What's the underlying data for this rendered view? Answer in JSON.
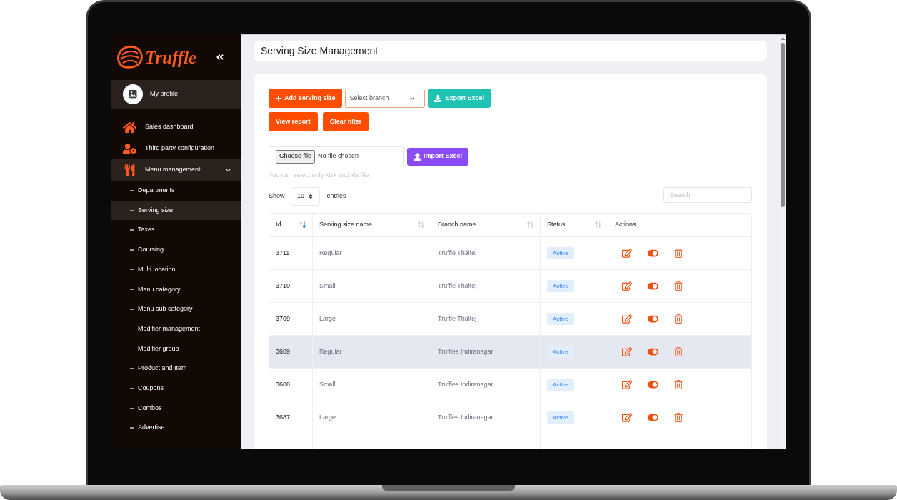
{
  "sidebar": {
    "brand": "Truffle",
    "profile": {
      "label": "My profile"
    },
    "items": [
      {
        "label": "Sales dashboard",
        "selected": false
      },
      {
        "label": "Third party configuration",
        "selected": false
      },
      {
        "label": "Menu management",
        "selected": true,
        "expanded": true,
        "children": [
          {
            "label": "Departments",
            "selected": false
          },
          {
            "label": "Serving size",
            "selected": true
          },
          {
            "label": "Taxes",
            "selected": false
          },
          {
            "label": "Coursing",
            "selected": false
          },
          {
            "label": "Multi location",
            "selected": false
          },
          {
            "label": "Menu category",
            "selected": false
          },
          {
            "label": "Menu sub category",
            "selected": false
          },
          {
            "label": "Modifier management",
            "selected": false
          },
          {
            "label": "Modifier group",
            "selected": false
          },
          {
            "label": "Product and Item",
            "selected": false
          },
          {
            "label": "Coupons",
            "selected": false
          },
          {
            "label": "Combos",
            "selected": false
          },
          {
            "label": "Advertise",
            "selected": false
          }
        ]
      }
    ]
  },
  "header": {
    "title": "Serving Size Management"
  },
  "toolbar": {
    "add_button": "Add serving size",
    "branch_select": {
      "placeholder": "Select branch"
    },
    "export_button": "Export Excel",
    "view_report_button": "View report",
    "clear_filter_button": "Clear filter"
  },
  "import": {
    "choose_button": "Choose file",
    "file_status": "No file chosen",
    "import_button": "Import Excel",
    "hint": "You can select only xlsx and xls file"
  },
  "table_controls": {
    "show_label": "Show",
    "page_size": "10",
    "entries_label": "entries",
    "search": {
      "placeholder": "Search"
    }
  },
  "table": {
    "columns": [
      {
        "label": "Id",
        "sortable": true,
        "sorted": true
      },
      {
        "label": "Serving size name",
        "sortable": true,
        "sorted": false
      },
      {
        "label": "Branch name",
        "sortable": true,
        "sorted": false
      },
      {
        "label": "Status",
        "sortable": true,
        "sorted": false
      },
      {
        "label": "Actions",
        "sortable": false
      }
    ],
    "rows": [
      {
        "id": "3711",
        "serving_size": "Regular",
        "branch": "Truffle Thaltej",
        "status": "Active",
        "enabled": true,
        "selected": false
      },
      {
        "id": "3710",
        "serving_size": "Small",
        "branch": "Truffle Thaltej",
        "status": "Active",
        "enabled": true,
        "selected": false
      },
      {
        "id": "3709",
        "serving_size": "Large",
        "branch": "Truffle Thaltej",
        "status": "Active",
        "enabled": true,
        "selected": false
      },
      {
        "id": "3689",
        "serving_size": "Regular",
        "branch": "Truffles Indiranagar",
        "status": "Active",
        "enabled": true,
        "selected": true
      },
      {
        "id": "3688",
        "serving_size": "Small",
        "branch": "Truffles Indiranagar",
        "status": "Active",
        "enabled": true,
        "selected": false
      },
      {
        "id": "3687",
        "serving_size": "Large",
        "branch": "Truffles Indiranagar",
        "status": "Active",
        "enabled": true,
        "selected": false
      }
    ]
  }
}
